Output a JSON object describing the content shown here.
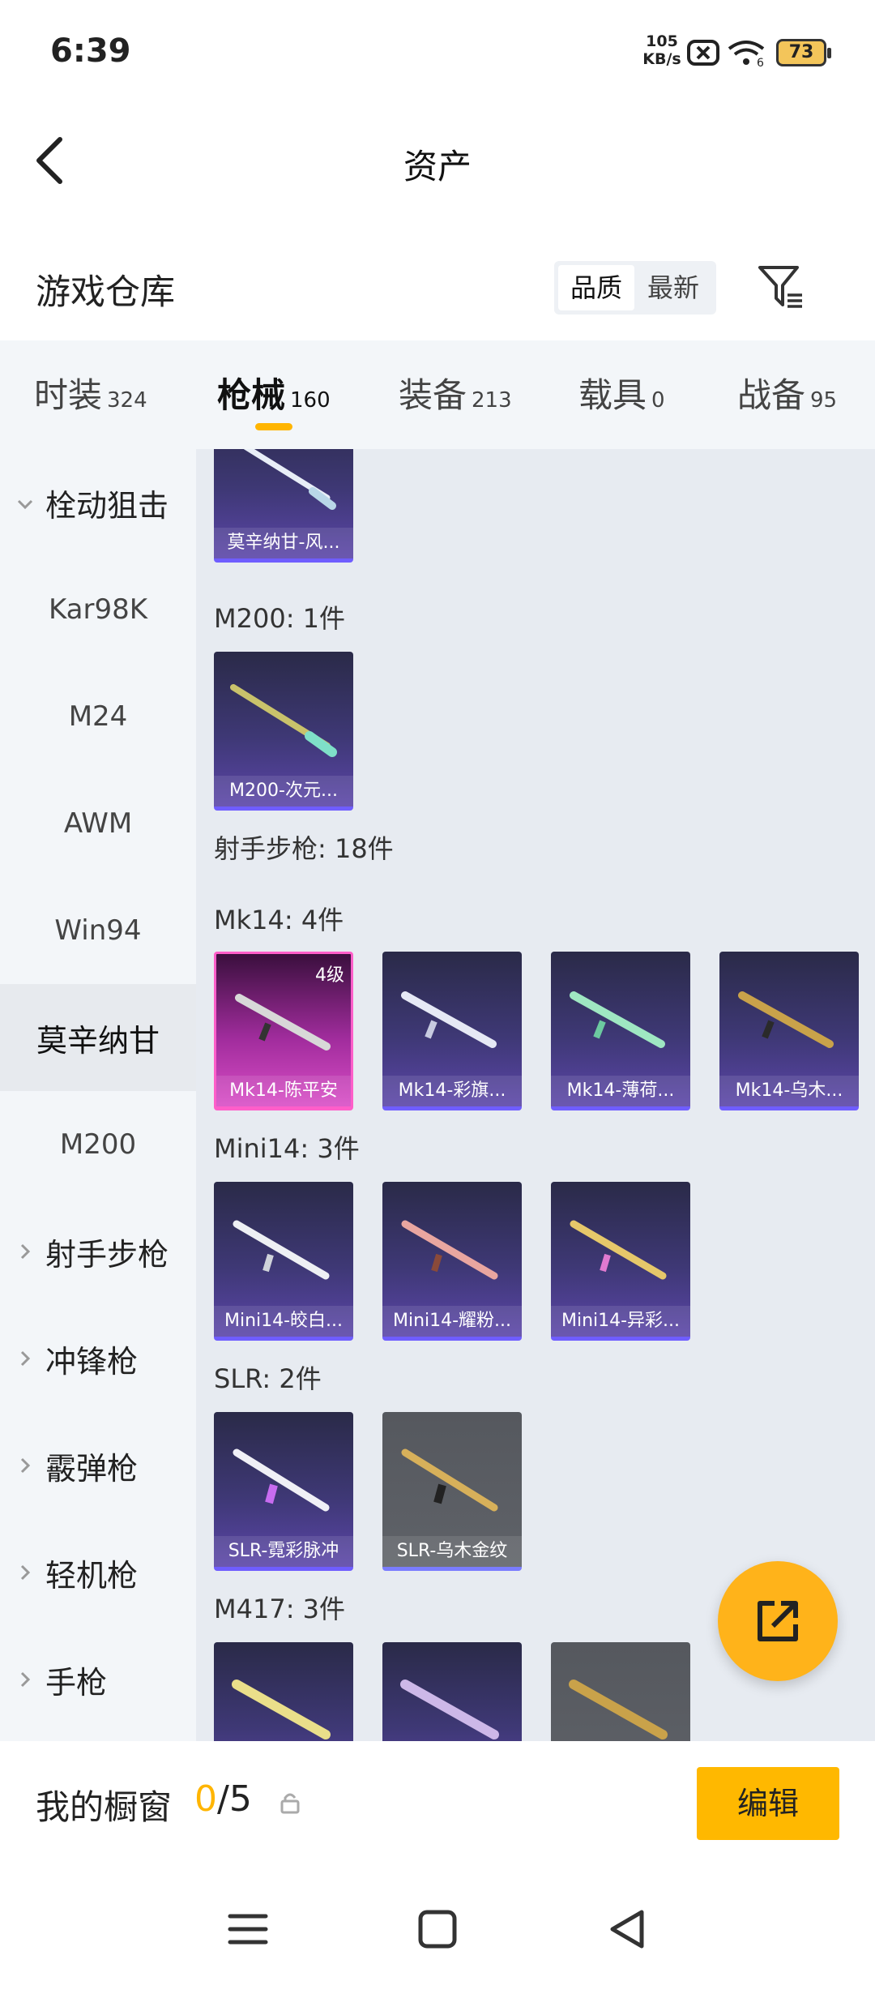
{
  "status_bar": {
    "time": "6:39",
    "net_speed_value": "105",
    "net_speed_unit": "KB/s",
    "battery": "73"
  },
  "header": {
    "title": "资产"
  },
  "warehouse": {
    "title": "游戏仓库",
    "sort_quality": "品质",
    "sort_latest": "最新"
  },
  "tabs": [
    {
      "label": "时装",
      "count": "324"
    },
    {
      "label": "枪械",
      "count": "160",
      "active": true
    },
    {
      "label": "装备",
      "count": "213"
    },
    {
      "label": "载具",
      "count": "0"
    },
    {
      "label": "战备",
      "count": "95"
    }
  ],
  "sidebar": {
    "items": [
      {
        "label": "栓动狙击",
        "type": "expanded"
      },
      {
        "label": "Kar98K"
      },
      {
        "label": "M24"
      },
      {
        "label": "AWM"
      },
      {
        "label": "Win94"
      },
      {
        "label": "莫辛纳甘",
        "active": true
      },
      {
        "label": "M200"
      },
      {
        "label": "射手步枪",
        "type": "collapsed"
      },
      {
        "label": "冲锋枪",
        "type": "collapsed"
      },
      {
        "label": "霰弹枪",
        "type": "collapsed"
      },
      {
        "label": "轻机枪",
        "type": "collapsed"
      },
      {
        "label": "手枪",
        "type": "collapsed"
      }
    ]
  },
  "groups": {
    "mosin": {
      "cards": [
        {
          "name": "莫辛纳甘-风..."
        }
      ]
    },
    "m200": {
      "title": "M200: 1件",
      "cards": [
        {
          "name": "M200-次元..."
        }
      ]
    },
    "dmr": {
      "title": "射手步枪: 18件"
    },
    "mk14": {
      "title": "Mk14: 4件",
      "cards": [
        {
          "name": "Mk14-陈平安",
          "level": "4级"
        },
        {
          "name": "Mk14-彩旗..."
        },
        {
          "name": "Mk14-薄荷..."
        },
        {
          "name": "Mk14-乌木..."
        }
      ]
    },
    "mini14": {
      "title": "Mini14: 3件",
      "cards": [
        {
          "name": "Mini14-皎白..."
        },
        {
          "name": "Mini14-耀粉..."
        },
        {
          "name": "Mini14-异彩..."
        }
      ]
    },
    "slr": {
      "title": "SLR: 2件",
      "cards": [
        {
          "name": "SLR-霓彩脉冲"
        },
        {
          "name": "SLR-乌木金纹"
        }
      ]
    },
    "m417": {
      "title": "M417: 3件"
    }
  },
  "showcase": {
    "label": "我的橱窗",
    "used": "0",
    "total": "/5",
    "edit_label": "编辑"
  },
  "colors": {
    "accent": "#ffb500",
    "card_purple": "#5b45a8",
    "card_gold": "#d94dc6",
    "card_gray": "#5f6268"
  }
}
